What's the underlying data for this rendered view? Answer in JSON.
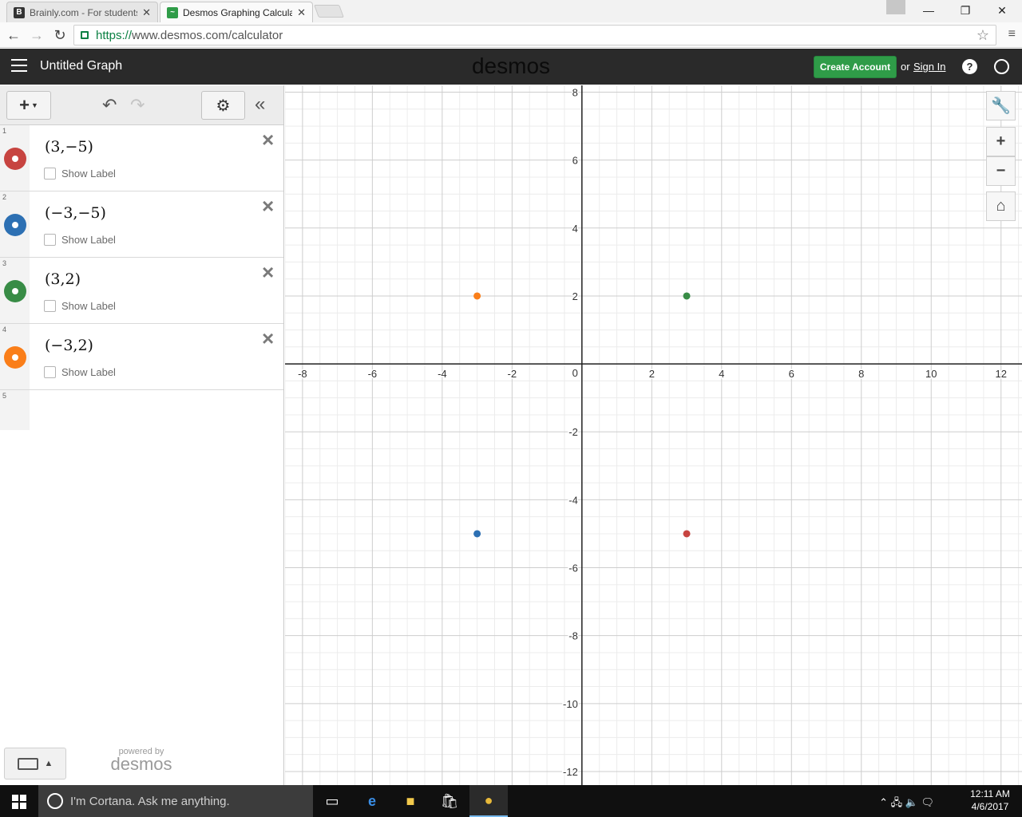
{
  "browser": {
    "tabs": [
      {
        "title": "Brainly.com - For students",
        "favicon": "brainly-icon",
        "active": false
      },
      {
        "title": "Desmos Graphing Calculator",
        "favicon": "desmos-icon",
        "active": true
      }
    ],
    "url_scheme": "https://",
    "url_rest": "www.desmos.com/calculator"
  },
  "header": {
    "title": "Untitled Graph",
    "brand": "desmos",
    "create_account": "Create Account",
    "or": "or",
    "sign_in": "Sign In",
    "help": "?"
  },
  "expressions": [
    {
      "index": "1",
      "latex": "(3,−5)",
      "x": 3,
      "y": -5,
      "color": "#c74440",
      "show_label": "Show Label"
    },
    {
      "index": "2",
      "latex": "(−3,−5)",
      "x": -3,
      "y": -5,
      "color": "#2d70b3",
      "show_label": "Show Label"
    },
    {
      "index": "3",
      "latex": "(3,2)",
      "x": 3,
      "y": 2,
      "color": "#388c46",
      "show_label": "Show Label"
    },
    {
      "index": "4",
      "latex": "(−3,2)",
      "x": -3,
      "y": 2,
      "color": "#fa7e19",
      "show_label": "Show Label"
    },
    {
      "index": "5"
    }
  ],
  "panel_footer": {
    "powered_by": "powered by",
    "brand": "desmos"
  },
  "graph": {
    "xlim": [
      -8.5,
      12.6
    ],
    "ylim": [
      -12.4,
      8.2
    ],
    "major_step": 2,
    "minor_step": 0.5,
    "x_tick_labels": [
      "-8",
      "-6",
      "-4",
      "-2",
      "2",
      "4",
      "6",
      "8",
      "10",
      "12"
    ],
    "y_tick_labels": [
      "8",
      "6",
      "4",
      "2",
      "-2",
      "-4",
      "-6",
      "-8",
      "-10",
      "-12"
    ],
    "origin_label": "0"
  },
  "taskbar": {
    "search_placeholder": "I'm Cortana. Ask me anything.",
    "time": "12:11 AM",
    "date": "4/6/2017"
  }
}
